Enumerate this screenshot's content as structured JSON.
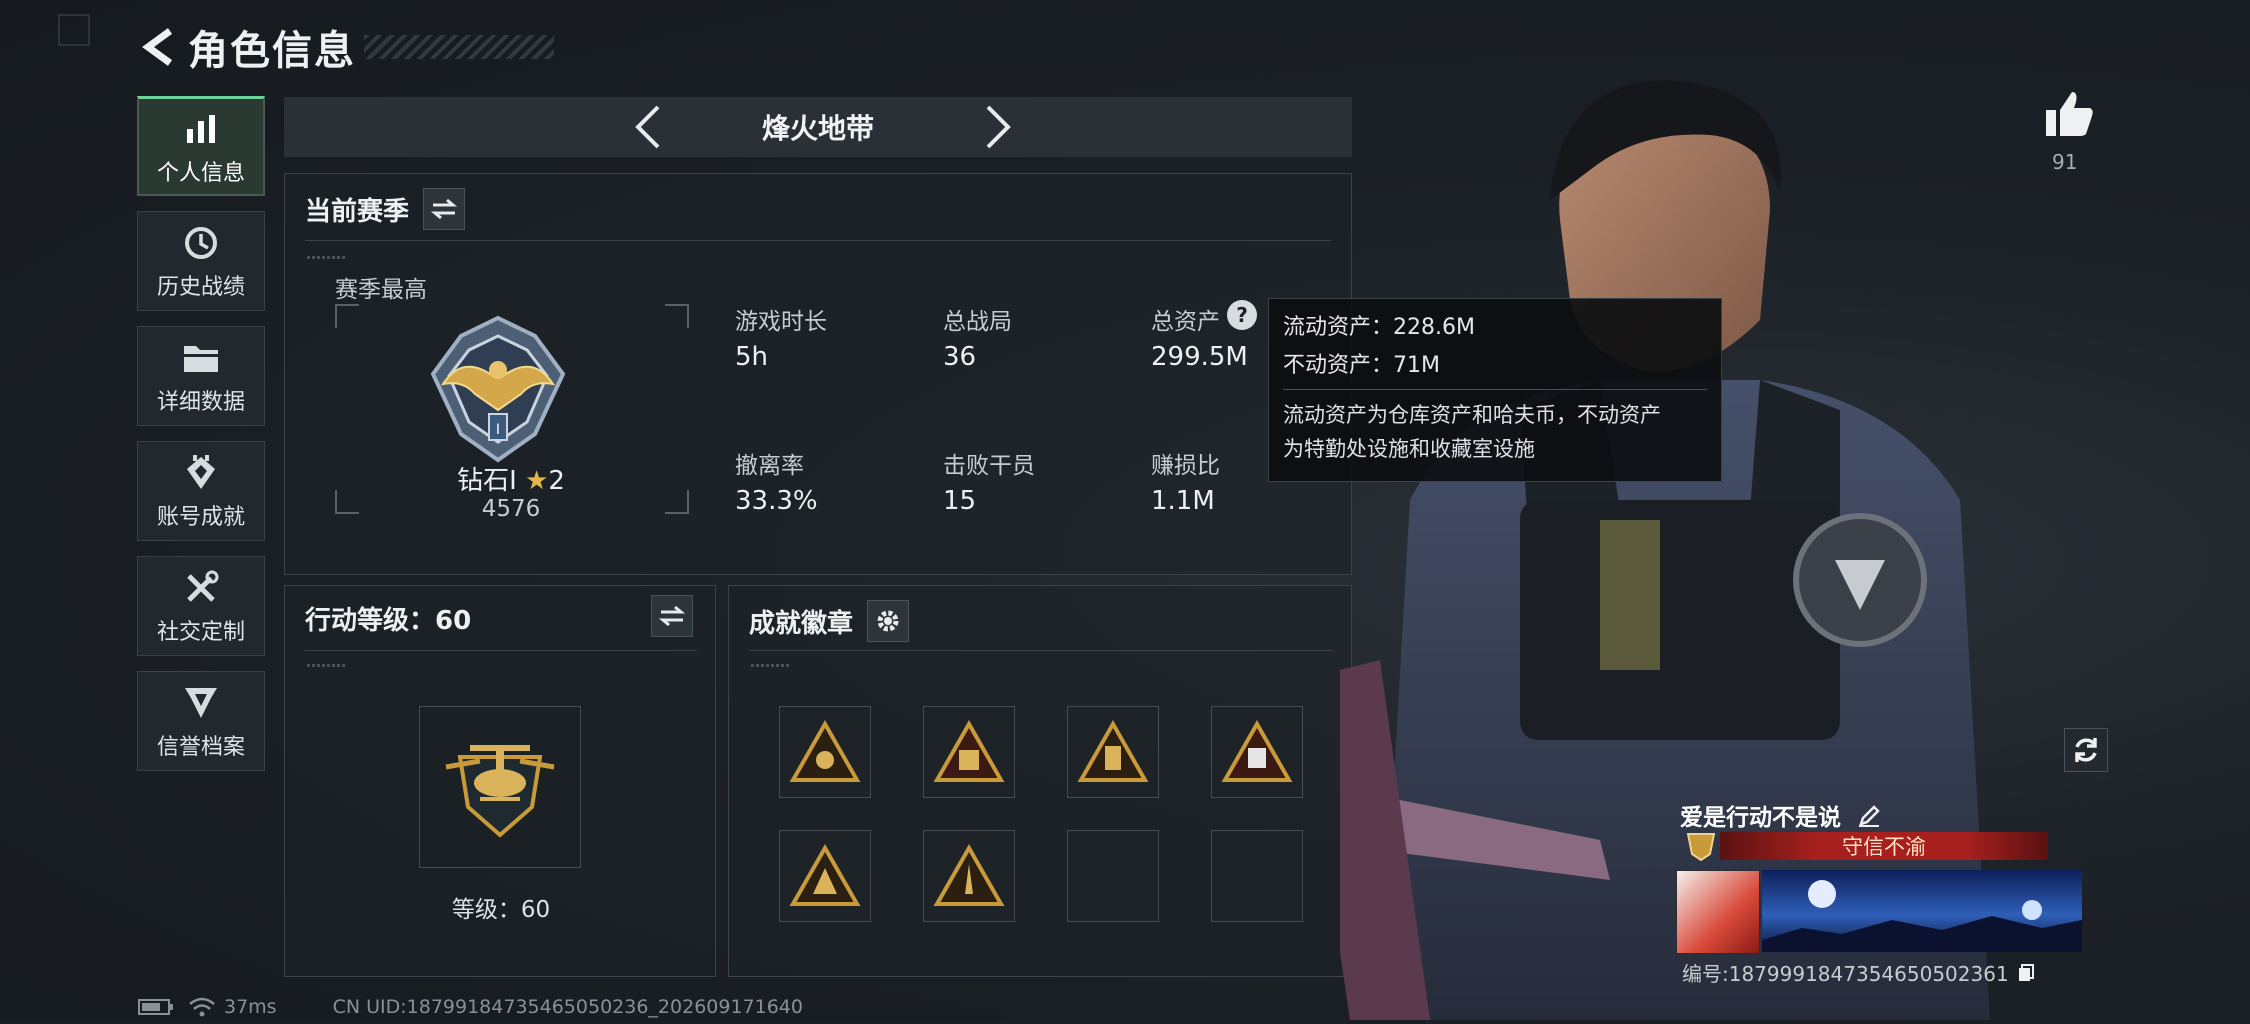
{
  "header": {
    "title": "角色信息"
  },
  "sidebar": {
    "items": [
      {
        "label": "个人信息",
        "icon": "bar-chart-icon",
        "active": true
      },
      {
        "label": "历史战绩",
        "icon": "history-clock-icon"
      },
      {
        "label": "详细数据",
        "icon": "folder-icon"
      },
      {
        "label": "账号成就",
        "icon": "achievement-icon"
      },
      {
        "label": "社交定制",
        "icon": "wrench-tools-icon"
      },
      {
        "label": "信誉档案",
        "icon": "credit-shield-icon"
      }
    ]
  },
  "mode": {
    "title": "烽火地带"
  },
  "season": {
    "title": "当前赛季",
    "best_label": "赛季最高",
    "rank": "钻石Ⅰ",
    "stars": "2",
    "score": "4576",
    "stats": [
      {
        "label": "游戏时长",
        "value": "5h"
      },
      {
        "label": "总战局",
        "value": "36"
      },
      {
        "label": "总资产",
        "value": "299.5M"
      },
      {
        "label": "撤离率",
        "value": "33.3%"
      },
      {
        "label": "击败干员",
        "value": "15"
      },
      {
        "label": "赚损比",
        "value": "1.1M"
      }
    ]
  },
  "tooltip": {
    "liquid": "流动资产：228.6M",
    "fixed": "不动资产：71M",
    "desc_1": "流动资产为仓库资产和哈夫币，不动资产",
    "desc_2": "为特勤处设施和收藏室设施"
  },
  "level": {
    "title": "行动等级：60",
    "level_text": "等级：60"
  },
  "badges": {
    "title": "成就徽章",
    "count_filled": 6,
    "count_empty": 2
  },
  "like": {
    "count": "91"
  },
  "player": {
    "name": "爱是行动不是说",
    "title_tag": "守信不渝",
    "id_text": "编号:1879991847354650502361"
  },
  "status": {
    "ping": "37ms",
    "uid": "CN UID:18799184735465050236_202609171640"
  },
  "colors": {
    "accent_green": "#6fd39e",
    "gold": "#c99a3a",
    "title_red": "#a8201d"
  }
}
